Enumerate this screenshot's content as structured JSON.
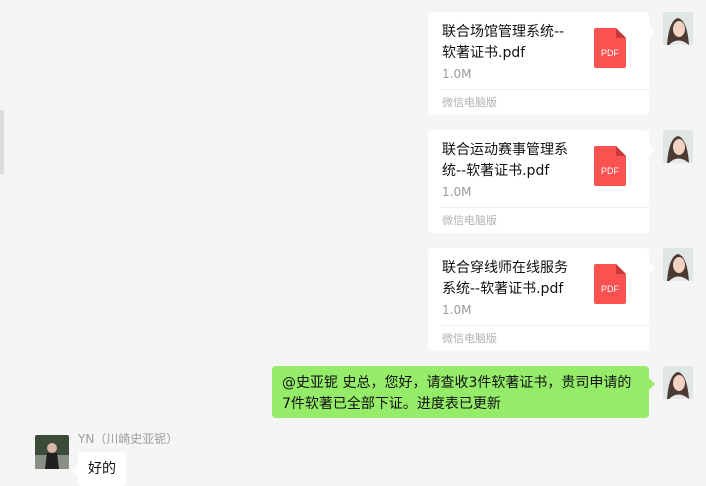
{
  "messages": [
    {
      "type": "file",
      "sender": "me",
      "name": "联合场馆管理系统--软著证书.pdf",
      "size": "1.0M",
      "source": "微信电脑版",
      "icon": "pdf-file-icon",
      "icon_label": "PDF"
    },
    {
      "type": "file",
      "sender": "me",
      "name": "联合运动赛事管理系统--软著证书.pdf",
      "size": "1.0M",
      "source": "微信电脑版",
      "icon": "pdf-file-icon",
      "icon_label": "PDF"
    },
    {
      "type": "file",
      "sender": "me",
      "name": "联合穿线师在线服务系统--软著证书.pdf",
      "size": "1.0M",
      "source": "微信电脑版",
      "icon": "pdf-file-icon",
      "icon_label": "PDF"
    },
    {
      "type": "text",
      "sender": "me",
      "text": "@史亚铌 史总，您好，请查收3件软著证书，贵司申请的7件软著已全部下证。进度表已更新"
    },
    {
      "type": "text",
      "sender": "other",
      "sender_name": "YN（川崎史亚铌）",
      "text": "好的"
    }
  ],
  "colors": {
    "background": "#f5f5f5",
    "my_bubble": "#95ec69",
    "other_bubble": "#ffffff",
    "pdf_red": "#fa5151",
    "meta_gray": "#999999"
  }
}
